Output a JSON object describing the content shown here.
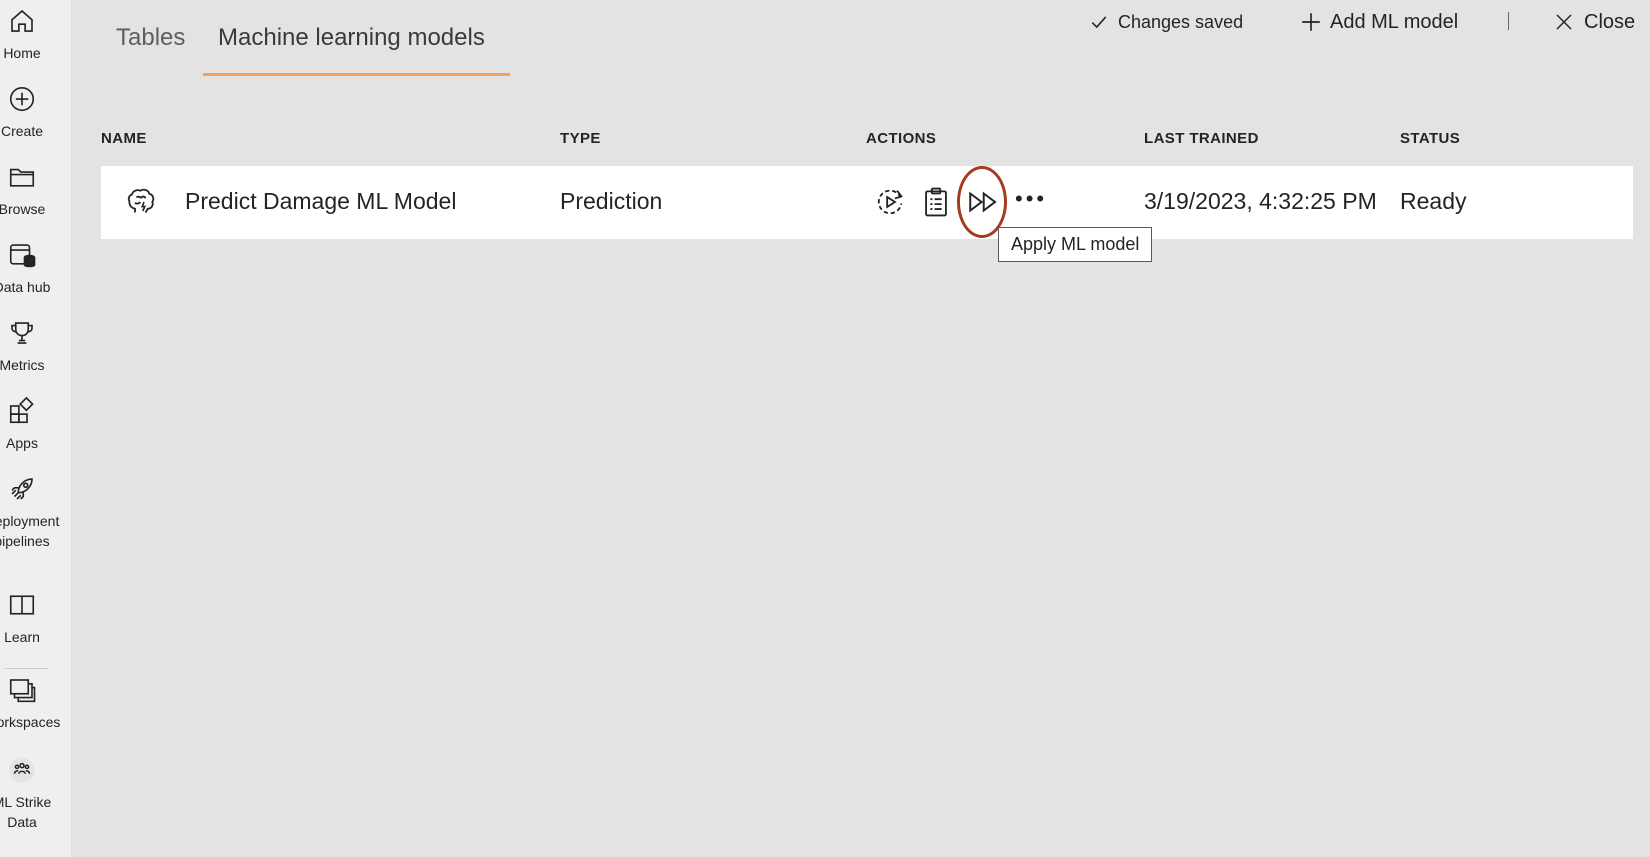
{
  "sidebar": {
    "items": [
      {
        "label": "Home",
        "icon": "home-icon"
      },
      {
        "label": "Create",
        "icon": "create-icon"
      },
      {
        "label": "Browse",
        "icon": "browse-icon"
      },
      {
        "label": "Data hub",
        "icon": "data-hub-icon"
      },
      {
        "label": "Metrics",
        "icon": "metrics-icon"
      },
      {
        "label": "Apps",
        "icon": "apps-icon"
      },
      {
        "label": "Deployment\npipelines",
        "icon": "deployment-pipelines-icon"
      },
      {
        "label": "Learn",
        "icon": "learn-icon"
      },
      {
        "label": "Workspaces",
        "icon": "workspaces-icon"
      },
      {
        "label": "ML Strike\nData",
        "icon": "workspace-icon"
      }
    ]
  },
  "tabs": [
    {
      "label": "Tables",
      "active": false
    },
    {
      "label": "Machine learning models",
      "active": true
    }
  ],
  "header": {
    "saved_status": "Changes saved",
    "add_label": "Add ML model",
    "close_label": "Close"
  },
  "table": {
    "columns": [
      "NAME",
      "TYPE",
      "ACTIONS",
      "LAST TRAINED",
      "STATUS"
    ],
    "rows": [
      {
        "name": "Predict Damage ML Model",
        "type": "Prediction",
        "last_trained": "3/19/2023, 4:32:25 PM",
        "status": "Ready",
        "actions": [
          "train-icon",
          "training-report-icon",
          "apply-ml-model-icon",
          "more-options-icon"
        ]
      }
    ]
  },
  "tooltip": {
    "text": "Apply ML model"
  },
  "colors": {
    "background": "#e3e3e3",
    "row_background": "#ffffff",
    "tab_underline": "#f2a45a",
    "highlight_ring": "#a63b1e"
  }
}
